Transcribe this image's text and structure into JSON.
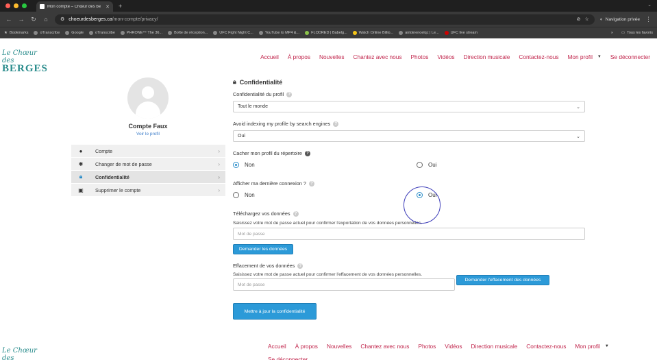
{
  "browser": {
    "tab_title": "Mon compte – Chœur des be",
    "url_domain": "choeurdesberges.ca",
    "url_path": "/mon-compte/privacy/",
    "private_label": "Navigation privée",
    "bookmarks": [
      "Bookmarks",
      "oTranscribe",
      "Google",
      "oTranscribe",
      "PHRONE™ The 36...",
      "Boîte de réception...",
      "UFC Fight Night C...",
      "YouTube to MP4 &...",
      "FLODRED | Babelg...",
      "Watch Online Billio...",
      "antoinenoelqc | Le...",
      "UFC live stream"
    ],
    "all_bookmarks": "Tous les favoris",
    "colors": {
      "chrome_bg": "#1f1f1f",
      "toolbar_bg": "#3a3a3a"
    }
  },
  "logo": {
    "line1": "Le Chœur des",
    "line2": "BERGES"
  },
  "nav": [
    "Accueil",
    "À propos",
    "Nouvelles",
    "Chantez avec nous",
    "Photos",
    "Vidéos",
    "Direction musicale",
    "Contactez-nous",
    "Mon profil"
  ],
  "nav_logout": "Se déconnecter",
  "profile": {
    "name": "Compte Faux",
    "view_link": "Voir le profil"
  },
  "menu": [
    {
      "icon": "user-icon",
      "label": "Compte",
      "active": false
    },
    {
      "icon": "asterisk-icon",
      "label": "Changer de mot de passe",
      "active": false
    },
    {
      "icon": "lock-icon",
      "label": "Confidentialité",
      "active": true
    },
    {
      "icon": "trash-icon",
      "label": "Supprimer le compte",
      "active": false
    }
  ],
  "form": {
    "title": "Confidentialité",
    "privacy_label": "Confidentialité du profil",
    "privacy_value": "Tout le monde",
    "indexing_label": "Avoid indexing my profile by search engines",
    "indexing_value": "Oui",
    "hide_label": "Cacher mon profil du répertoire",
    "hide_no": "Non",
    "hide_yes": "Oui",
    "hide_selected": "Non",
    "lastlogin_label": "Afficher ma dernière connexion ?",
    "lastlogin_no": "Non",
    "lastlogin_yes": "Oui",
    "lastlogin_selected": "Oui",
    "download_label": "Téléchargez vos données",
    "download_desc": "Saisissez votre mot de passe actuel pour confirmer l'exportation de vos données personnelles.",
    "download_placeholder": "Mot de passe",
    "download_button": "Demander les données",
    "erase_label": "Effacement de vos données",
    "erase_desc": "Saisissez votre mot de passe actuel pour confirmer l'effacement de vos données personnelles.",
    "erase_placeholder": "Mot de passe",
    "erase_button": "Demander l'effacement des données",
    "submit_button": "Mettre à jour la confidentialité"
  },
  "colors": {
    "accent_link": "#c0234a",
    "button": "#2c9ad8",
    "brand": "#2a8c8c"
  }
}
